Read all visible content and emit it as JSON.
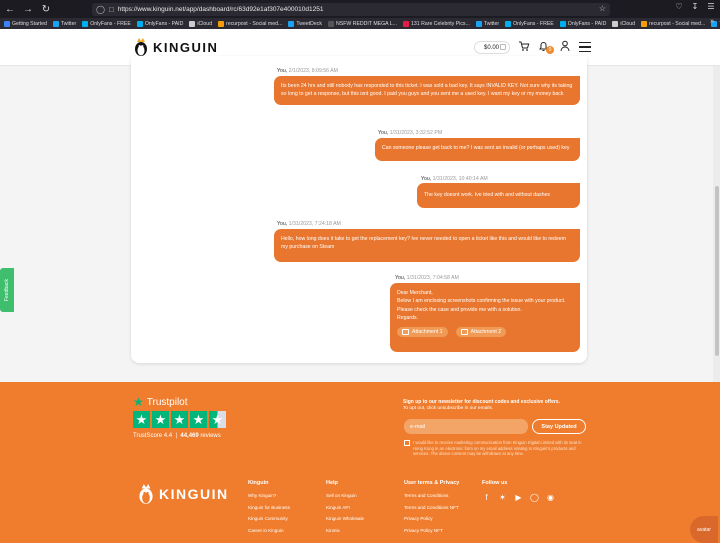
{
  "browser": {
    "url": "https://www.kinguin.net/app/dashboard/rc/63d92e1af307e400010d1251",
    "bookmarks": [
      {
        "label": "Getting Started",
        "color": "#3b82f6"
      },
      {
        "label": "Twitter",
        "color": "#1da1f2"
      },
      {
        "label": "OnlyFans - FREE",
        "color": "#00aff0"
      },
      {
        "label": "OnlyFans - PAID",
        "color": "#00aff0"
      },
      {
        "label": "iCloud",
        "color": "#cccccc"
      },
      {
        "label": "recurpost - Social med...",
        "color": "#f59e0b"
      },
      {
        "label": "TweetDeck",
        "color": "#1da1f2"
      },
      {
        "label": "NSFW REDDIT MEGA L...",
        "color": "#555555"
      },
      {
        "label": "131 Rare Celebrity Pics...",
        "color": "#e11d48"
      },
      {
        "label": "Twitter",
        "color": "#1da1f2"
      },
      {
        "label": "OnlyFans - FREE",
        "color": "#00aff0"
      },
      {
        "label": "OnlyFans - PAID",
        "color": "#00aff0"
      },
      {
        "label": "iCloud",
        "color": "#cccccc"
      },
      {
        "label": "recurpost - Social med...",
        "color": "#f59e0b"
      },
      {
        "label": "TweetDeck",
        "color": "#1da1f2"
      }
    ]
  },
  "header": {
    "brand": "KINGUIN",
    "balance": "$0.00",
    "notifications_count": "0"
  },
  "messages": [
    {
      "author": "You,",
      "date": "2/1/2023, 8:09:56 AM",
      "text": "Its been 24 hrs and still nobody has responded to this ticket. I was sold a bad key. It says INVALID KEY. Not sure why its taking so long to get a response, but this isnt good. I paid you guys and you sent me a used key. I want my key or my money back"
    },
    {
      "author": "You,",
      "date": "1/31/2023, 3:32:52 PM",
      "text": "Can someone please get back to me? I was sent an invalid (or perhaps used) key"
    },
    {
      "author": "You,",
      "date": "1/31/2023, 10:40:14 AM",
      "text": "The key doesnt work. Ive tried with and without dashes"
    },
    {
      "author": "You,",
      "date": "1/31/2023, 7:24:18 AM",
      "text": "Hello, how long does it take to get the replacement key? Ive never needed to open a ticket like this and would like to redeem my purchase on Steam"
    },
    {
      "author": "You,",
      "date": "1/31/2023, 7:04:58 AM",
      "lines": [
        "Dear Merchant,",
        "Below I am enclosing screenshots confirming the issue with your product.",
        "Please check the case and provide me with a solution.",
        "Regards."
      ],
      "attachments": [
        "Attachment 1",
        "Attachment 2"
      ]
    }
  ],
  "feedback_label": "Feedback",
  "footer": {
    "trustpilot_name": "Trustpilot",
    "trustscore_label": "TrustScore",
    "trustscore": "4.4",
    "reviews": "44,469",
    "reviews_label": "reviews",
    "newsletter_title": "Sign up to our newsletter for discount codes and exclusive offers.",
    "newsletter_sub": "To opt out, click unsubscribe in our emails.",
    "email_placeholder": "e-mail",
    "stay_button": "Stay Updated",
    "consent": "I would like to receive marketing communication from Kinguin Digital Limited with its seat in Hong Kong in an electronic form on my email address relating to Kinguin's products and services. The above consent may be withdrawn at any time.",
    "brand": "KINGUIN",
    "columns": [
      {
        "title": "Kinguin",
        "links": [
          "Why Kinguin?",
          "Kinguin for Business",
          "Kinguin Community",
          "Career in Kinguin"
        ]
      },
      {
        "title": "Help",
        "links": [
          "Sell on Kinguin",
          "Kinguin API",
          "Kinguin Wholesale",
          "Kinmix"
        ]
      },
      {
        "title": "User terms & Privacy",
        "links": [
          "Terms and Conditions",
          "Terms and Conditions NFT",
          "Privacy Policy",
          "Privacy Policy NFT"
        ]
      }
    ],
    "follow_title": "Follow us",
    "avatar_label": "avatar"
  },
  "colors": {
    "accent": "#ef7d2d",
    "bubble": "#e8762e",
    "trustpilot": "#00b67a"
  }
}
